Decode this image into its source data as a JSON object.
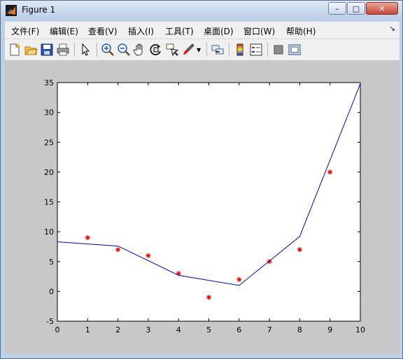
{
  "window": {
    "title": "Figure 1",
    "controls": {
      "minimize": "–",
      "maximize": "□",
      "close": "✕"
    }
  },
  "menubar": {
    "items": [
      "文件(F)",
      "编辑(E)",
      "查看(V)",
      "插入(I)",
      "工具(T)",
      "桌面(D)",
      "窗口(W)",
      "帮助(H)"
    ],
    "overflow_icon": "chevron-right-icon"
  },
  "toolbar": {
    "icons": [
      "new-figure-icon",
      "open-file-icon",
      "save-icon",
      "print-icon",
      "pointer-icon",
      "zoom-in-icon",
      "zoom-out-icon",
      "pan-hand-icon",
      "rotate-3d-icon",
      "data-cursor-icon",
      "brush-icon",
      "link-plot-icon",
      "colorbar-icon",
      "legend-icon",
      "hide-plot-tools-icon",
      "show-plot-tools-icon"
    ]
  },
  "colors": {
    "line": "#0000cc",
    "markers": "#ff0000",
    "figure_bg": "#c8c8c8",
    "axes_bg": "#ffffff"
  },
  "chart_data": {
    "type": "line",
    "title": "",
    "xlabel": "",
    "ylabel": "",
    "xlim": [
      0,
      10
    ],
    "ylim": [
      -5,
      35
    ],
    "xticks": [
      "0",
      "1",
      "2",
      "3",
      "4",
      "5",
      "6",
      "7",
      "8",
      "9",
      "10"
    ],
    "yticks": [
      "-5",
      "0",
      "5",
      "10",
      "15",
      "20",
      "25",
      "30",
      "35"
    ],
    "grid": false,
    "series": [
      {
        "style": "scatter",
        "marker": "*",
        "color": "#ff0000",
        "x": [
          1,
          2,
          3,
          4,
          5,
          6,
          7,
          8,
          9
        ],
        "y": [
          9,
          7,
          6,
          3,
          -1,
          2,
          5,
          7,
          20
        ]
      },
      {
        "style": "line",
        "color": "#0000cc",
        "x": [
          0,
          2,
          4,
          6,
          8,
          10
        ],
        "y": [
          8.3,
          7.6,
          2.7,
          1.0,
          9.2,
          34.8
        ]
      }
    ]
  }
}
